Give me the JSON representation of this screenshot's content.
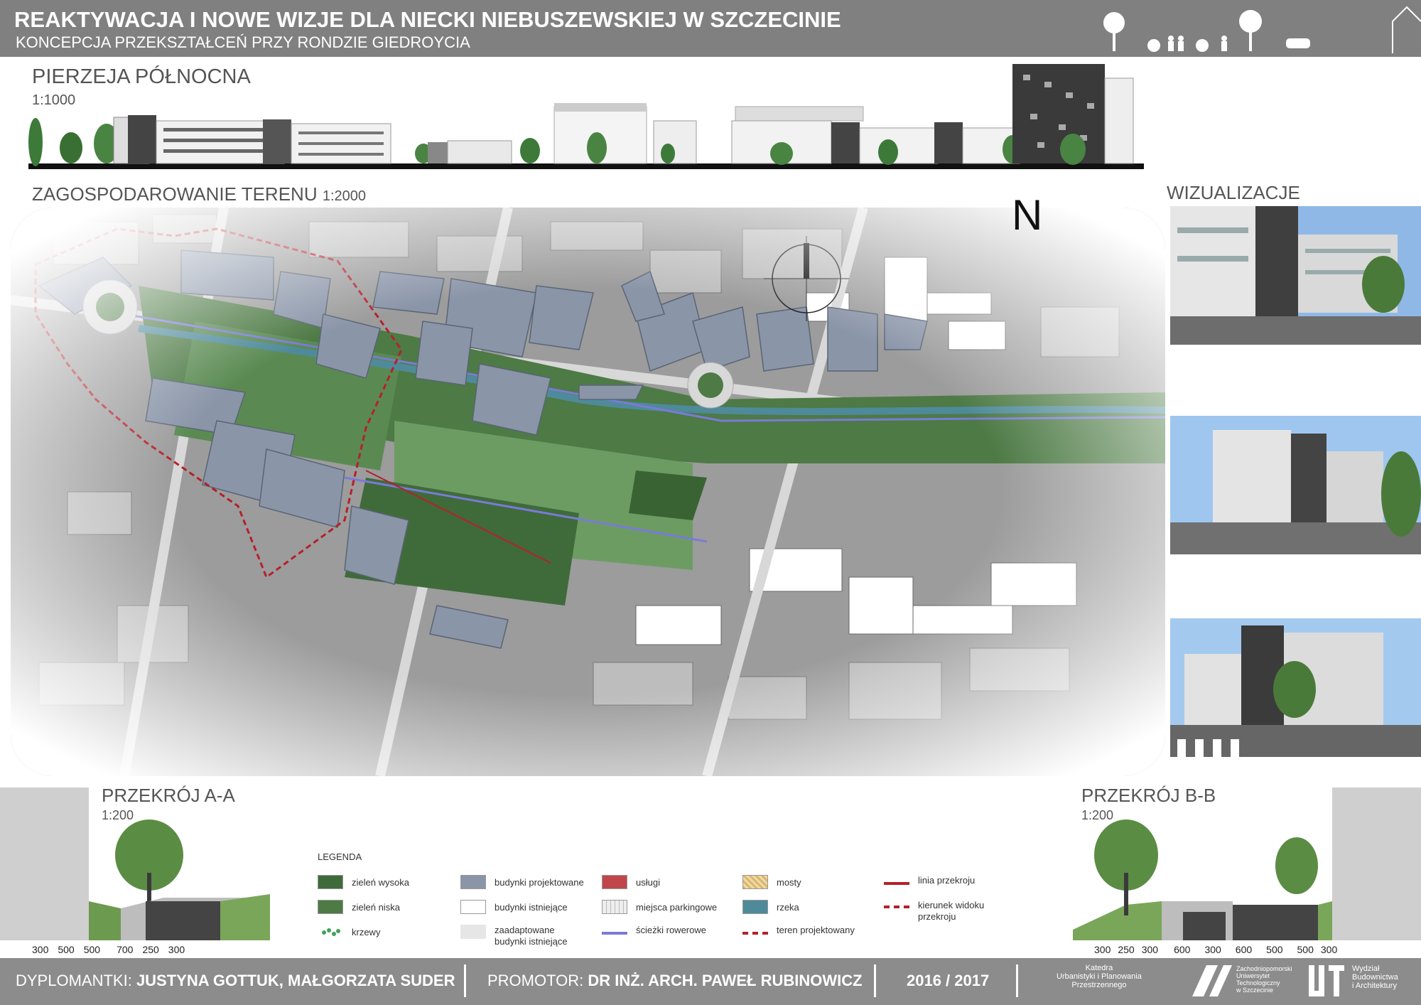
{
  "header": {
    "title": "REAKTYWACJA I NOWE WIZJE DLA NIECKI NIEBUSZEWSKIEJ W SZCZECINIE",
    "subtitle": "KONCEPCJA PRZEKSZTAŁCEŃ PRZY RONDZIE GIEDROYCIA"
  },
  "north_elevation": {
    "title": "PIERZEJA PÓŁNOCNA",
    "scale": "1:1000"
  },
  "site_plan": {
    "title": "ZAGOSPODAROWANIE TERENU",
    "scale": "1:2000",
    "north_label": "N"
  },
  "visualizations": {
    "title": "WIZUALIZACJE"
  },
  "section_aa": {
    "title": "PRZEKRÓJ A-A",
    "scale": "1:200",
    "dimensions": [
      "300",
      "500",
      "500",
      "700",
      "250",
      "300"
    ]
  },
  "section_bb": {
    "title": "PRZEKRÓJ B-B",
    "scale": "1:200",
    "dimensions": [
      "300",
      "250",
      "300",
      "600",
      "300",
      "600",
      "500",
      "500",
      "300"
    ]
  },
  "legend": {
    "title": "LEGENDA",
    "items": [
      {
        "label": "zieleń wysoka",
        "color": "#3f6b3a"
      },
      {
        "label": "zieleń niska",
        "color": "#4d7a45"
      },
      {
        "label": "krzewy",
        "color": "#3fa35a"
      },
      {
        "label": "budynki projektowane",
        "color": "#8a95a8"
      },
      {
        "label": "budynki istniejące",
        "color": "#ffffff"
      },
      {
        "label": "zaadaptowane budynki istniejące",
        "color": "#e6e6e6"
      },
      {
        "label": "usługi",
        "color": "#c0464b"
      },
      {
        "label": "miejsca parkingowe",
        "color": "#eeeeee"
      },
      {
        "label": "ścieżki rowerowe",
        "color": "#7a7ad8"
      },
      {
        "label": "mosty",
        "color": "#d9b870"
      },
      {
        "label": "rzeka",
        "color": "#4f8a9a"
      },
      {
        "label": "teren projektowany",
        "color": "#b5212a"
      },
      {
        "label": "linia przekroju",
        "color": "#b5212a"
      },
      {
        "label": "kierunek widoku przekroju",
        "color": "#b5212a"
      }
    ]
  },
  "footer": {
    "authors_label": "DYPLOMANTKI:",
    "authors": "JUSTYNA GOTTUK, MAŁGORZATA SUDER",
    "promotor_label": "PROMOTOR:",
    "promotor": "DR INŻ. ARCH. PAWEŁ RUBINOWICZ",
    "year": "2016 / 2017",
    "dept1": "Katedra",
    "dept2": "Urbanistyki i Planowania",
    "dept3": "Przestrzennego",
    "uni1": "Zachodniopomorski",
    "uni2": "Uniwersytet",
    "uni3": "Technologiczny",
    "uni4": "w Szczecinie",
    "fac1": "Wydział",
    "fac2": "Budownictwa",
    "fac3": "i Architektury"
  }
}
